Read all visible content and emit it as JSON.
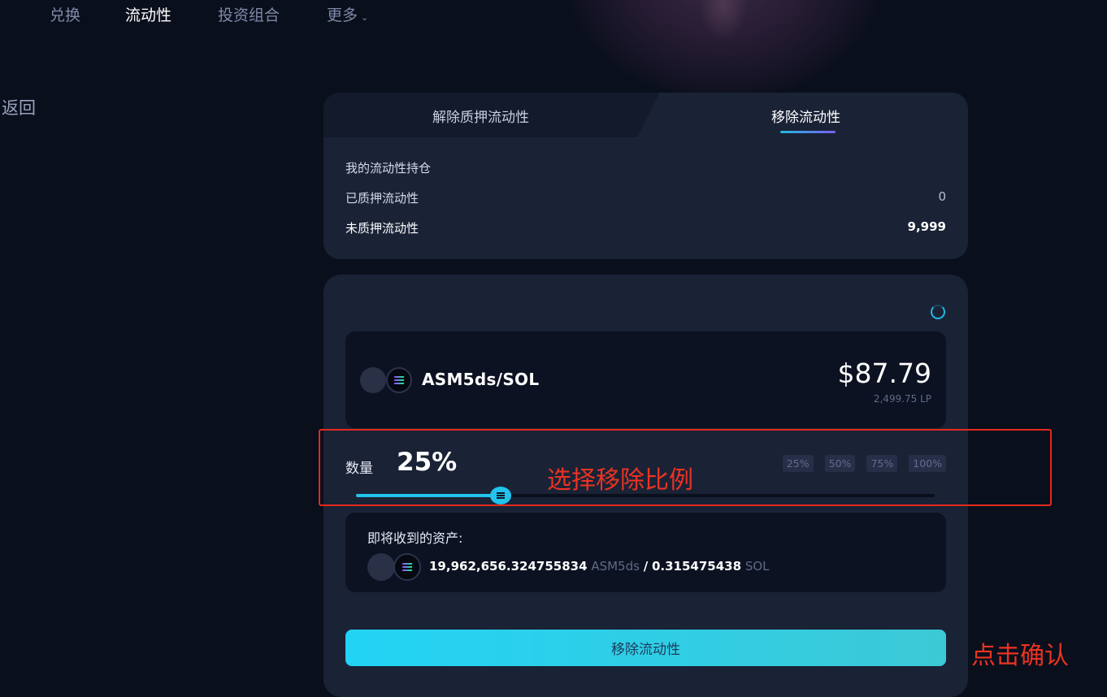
{
  "nav": {
    "items": [
      {
        "label": "兑换",
        "active": false
      },
      {
        "label": "流动性",
        "active": true
      },
      {
        "label": "投资组合",
        "active": false
      },
      {
        "label": "更多",
        "active": false
      }
    ]
  },
  "back_label": "返回",
  "tabs": {
    "unstake": "解除质押流动性",
    "remove": "移除流动性",
    "active": "移除流动性"
  },
  "holdings": {
    "title": "我的流动性持仓",
    "staked_label": "已质押流动性",
    "staked_value": "0",
    "unstaked_label": "未质押流动性",
    "unstaked_value": "9,999"
  },
  "pool": {
    "pair": "ASM5ds/SOL",
    "usd_value": "$87.79",
    "lp_amount": "2,499.75 LP"
  },
  "amount": {
    "label": "数量",
    "percent_text": "25%",
    "percent_value": 25,
    "presets": [
      "25%",
      "50%",
      "75%",
      "100%"
    ]
  },
  "receive": {
    "title": "即将收到的资产:",
    "amount_a": "19,962,656.324755834",
    "symbol_a": "ASM5ds",
    "separator": "/",
    "amount_b": "0.315475438",
    "symbol_b": "SOL"
  },
  "confirm_label": "移除流动性",
  "annotations": {
    "select_ratio": "选择移除比例",
    "click_confirm": "点击确认",
    "color": "#ea3322"
  },
  "colors": {
    "accent": "#22c3ec",
    "background": "#0a0f1c",
    "card": "#1a2236"
  }
}
